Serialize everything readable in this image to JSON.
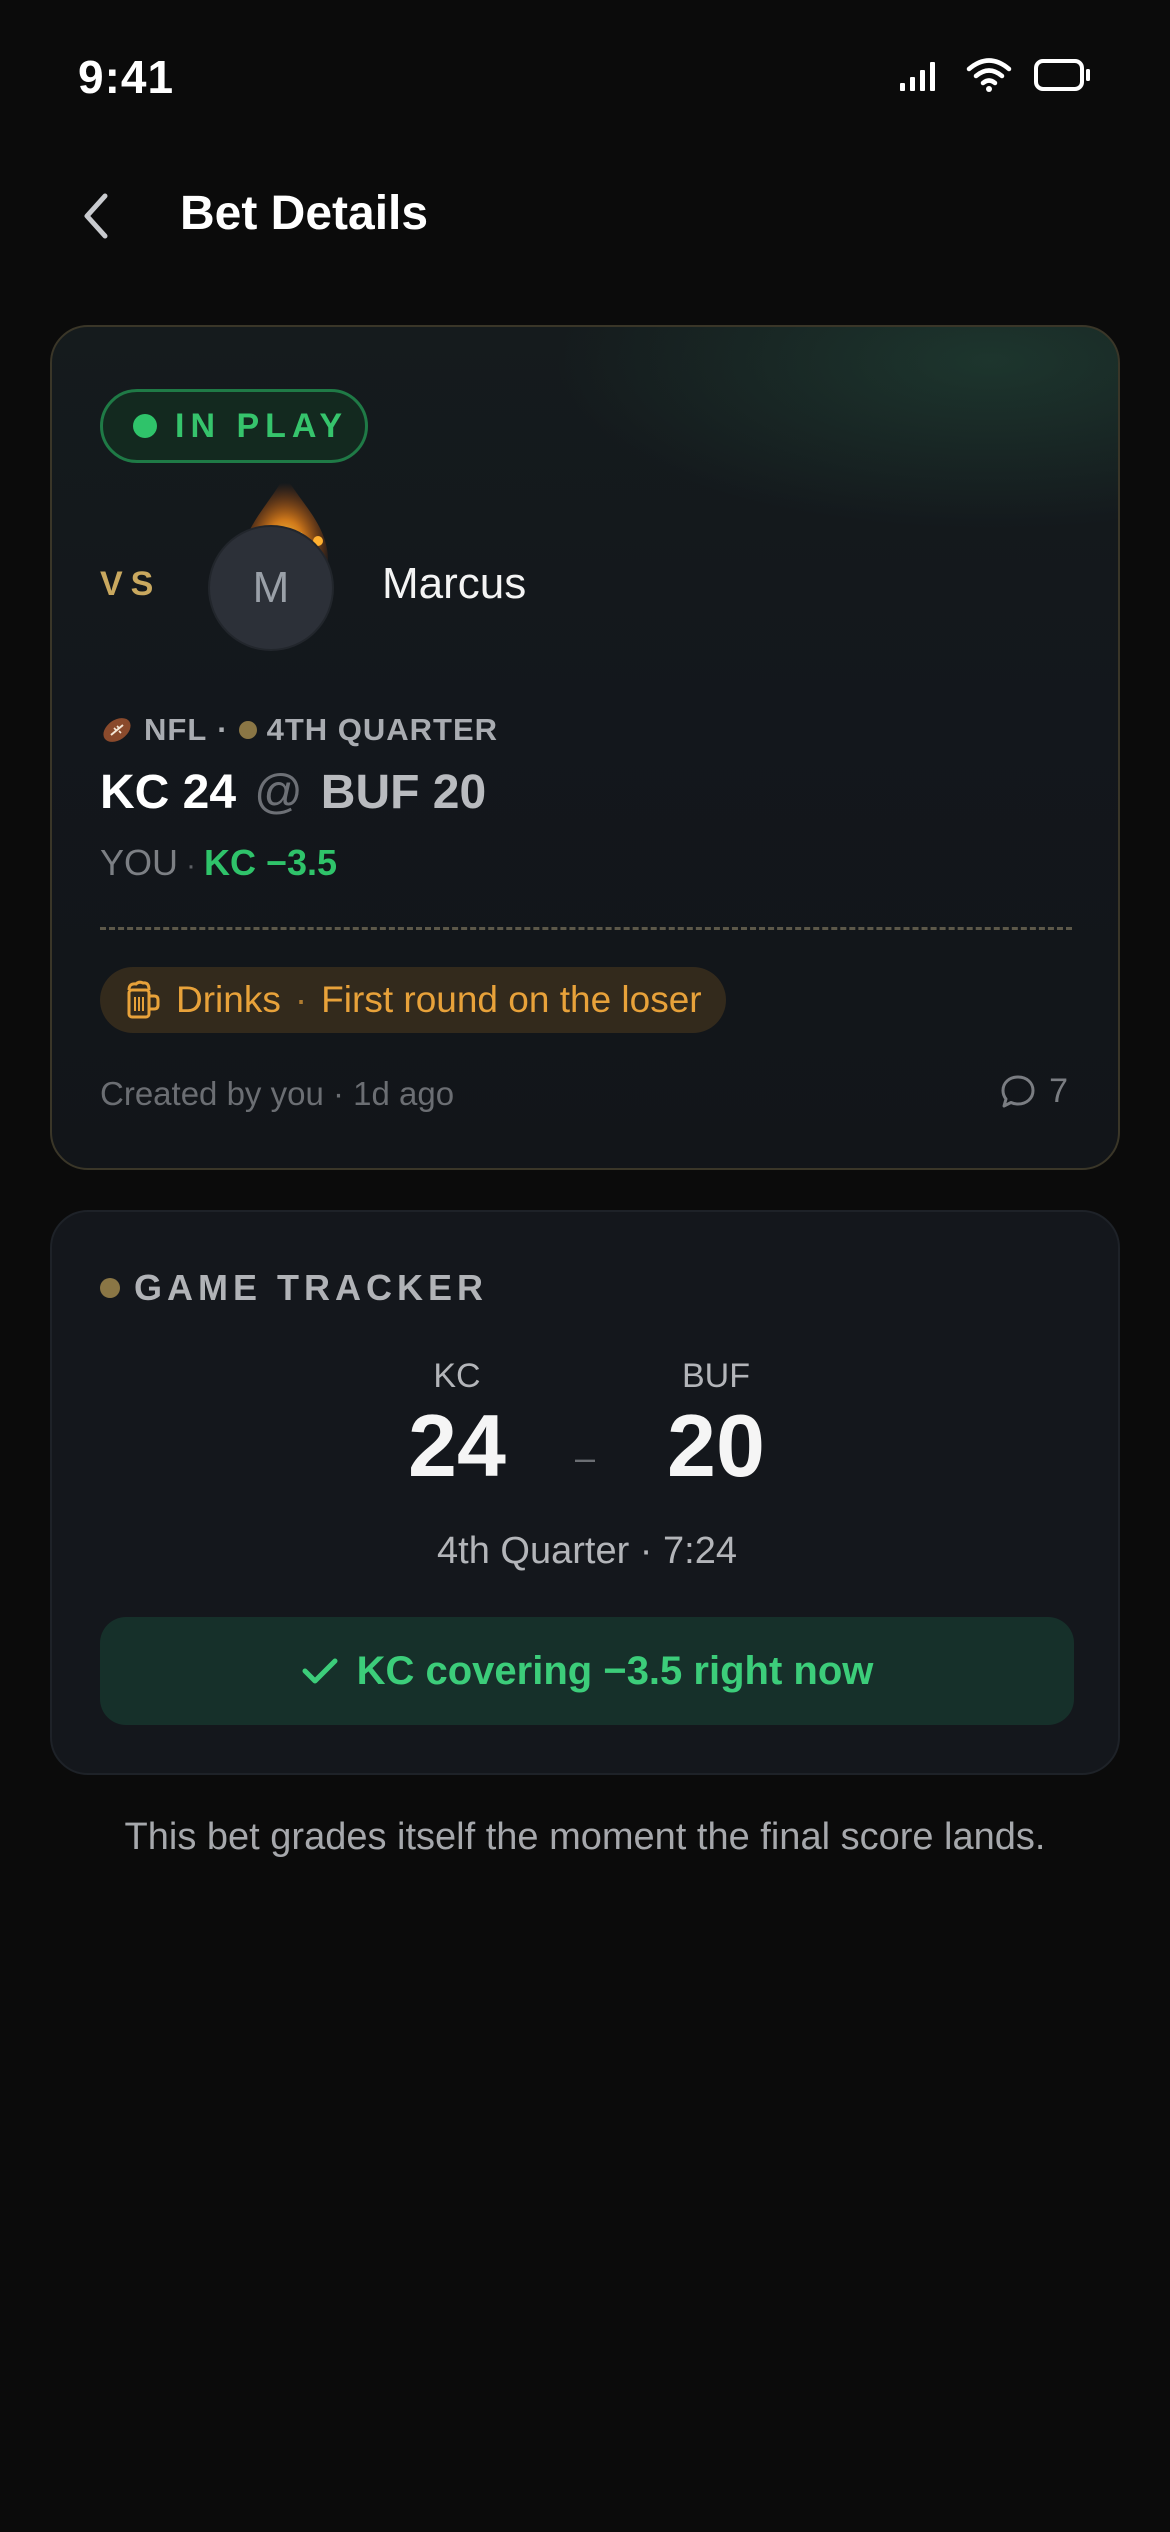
{
  "status_bar": {
    "time": "9:41"
  },
  "header": {
    "title": "Bet Details"
  },
  "bet": {
    "status": "IN PLAY",
    "vs_label": "VS",
    "opponent": {
      "initial": "M",
      "name": "Marcus"
    },
    "league": "NFL",
    "period": "4TH QUARTER",
    "home": "KC 24",
    "at": "@",
    "away": "BUF 20",
    "you_label": "YOU",
    "pick": "KC −3.5",
    "stakes": {
      "category": "Drinks",
      "text": "First round on the loser"
    },
    "created": "Created by you · 1d ago",
    "comment_count": "7"
  },
  "tracker": {
    "title": "GAME TRACKER",
    "home_team": "KC",
    "home_score": "24",
    "away_team": "BUF",
    "away_score": "20",
    "dash": "–",
    "clock": "4th Quarter · 7:24",
    "cover_text": "KC covering −3.5 right now"
  },
  "footer_note": "This bet grades itself the moment the final score lands.",
  "colors": {
    "accent_green": "#2fc36a",
    "gold": "#c9a85f",
    "orange": "#e8a23a",
    "background": "#0b0b0b"
  },
  "icons": [
    "signal-icon",
    "wifi-icon",
    "battery-icon",
    "back-chevron-icon",
    "football-icon",
    "beer-mug-icon",
    "comment-icon",
    "checkmark-icon"
  ]
}
